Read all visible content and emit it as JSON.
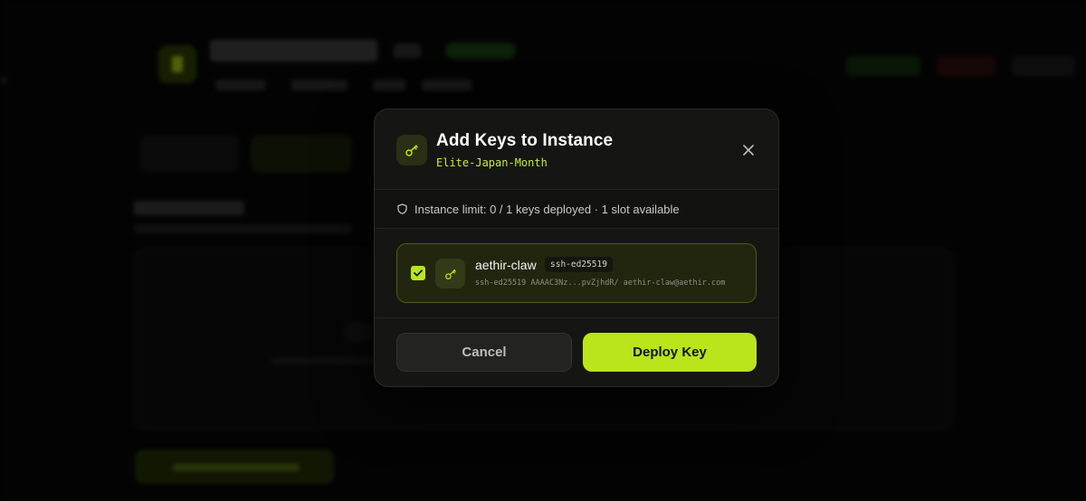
{
  "modal": {
    "title": "Add Keys to Instance",
    "instance_name": "Elite-Japan-Month",
    "limit_text": "Instance limit: 0 / 1 keys deployed · 1 slot available",
    "keys": [
      {
        "name": "aethir-claw",
        "type": "ssh-ed25519",
        "fingerprint": "ssh-ed25519 AAAAC3Nz...pvZjhdR/ aethir-claw@aethir.com",
        "selected": true
      }
    ],
    "cancel_label": "Cancel",
    "deploy_label": "Deploy Key"
  },
  "icons": {
    "header": "key-icon",
    "close": "close-icon",
    "limit": "shield-icon",
    "checkbox": "check-icon",
    "key_item": "key-icon"
  },
  "colors": {
    "accent": "#b9e51a",
    "modal_bg": "#151613",
    "page_bg": "#000000"
  }
}
